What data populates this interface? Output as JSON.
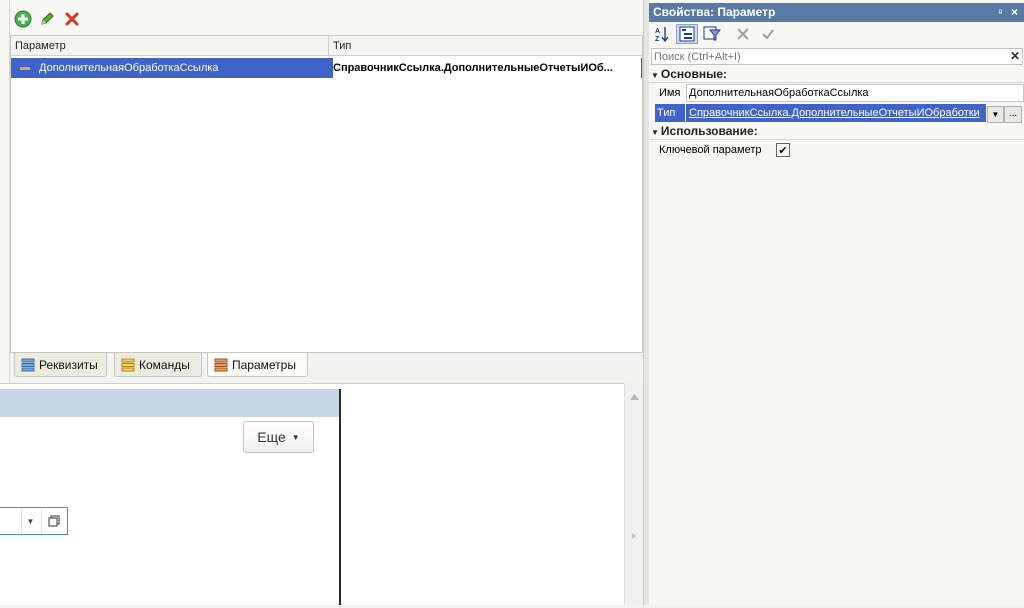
{
  "toolbar": {
    "add_icon": "add-circle-icon",
    "edit_icon": "pencil-icon",
    "delete_icon": "red-x-icon"
  },
  "grid": {
    "columns": [
      "Параметр",
      "Тип"
    ],
    "rows": [
      {
        "name": "ДополнительнаяОбработкаСсылка",
        "type": "СправочникСсылка.ДополнительныеОтчетыИОб..."
      }
    ]
  },
  "tabs": [
    {
      "label": "Реквизиты",
      "active": false
    },
    {
      "label": "Команды",
      "active": false
    },
    {
      "label": "Параметры",
      "active": true
    }
  ],
  "preview": {
    "more_button": "Еще"
  },
  "props": {
    "title": "Свойства: Параметр",
    "search_placeholder": "Поиск (Ctrl+Alt+I)",
    "section_main": "Основные:",
    "name_label": "Имя",
    "name_value": "ДополнительнаяОбработкаСсылка",
    "type_label": "Тип",
    "type_value": "СправочникСсылка.ДополнительныеОтчетыИОбработки",
    "section_usage": "Использование:",
    "key_label": "Ключевой параметр",
    "key_checked": true,
    "type_more": "..."
  },
  "colors": {
    "selection": "#3f63c8",
    "panel_title": "#5a7aa6",
    "preview_title": "#c8d7e6"
  }
}
